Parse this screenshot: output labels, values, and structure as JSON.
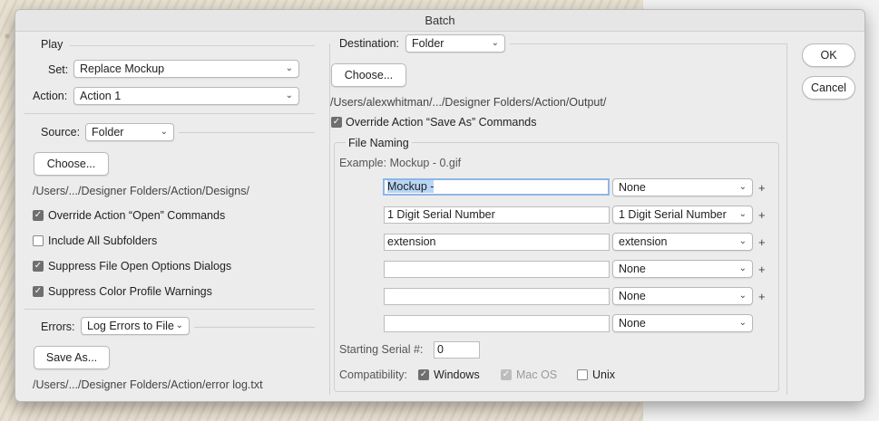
{
  "dialog": {
    "title": "Batch"
  },
  "play": {
    "heading": "Play",
    "set_label": "Set:",
    "set_value": "Replace Mockup",
    "action_label": "Action:",
    "action_value": "Action 1"
  },
  "source": {
    "label": "Source:",
    "value": "Folder",
    "choose_label": "Choose...",
    "path": "/Users/.../Designer Folders/Action/Designs/",
    "checkboxes": [
      {
        "label": "Override Action “Open” Commands",
        "checked": true
      },
      {
        "label": "Include All Subfolders",
        "checked": false
      },
      {
        "label": "Suppress File Open Options Dialogs",
        "checked": true
      },
      {
        "label": "Suppress Color Profile Warnings",
        "checked": true
      }
    ]
  },
  "errors": {
    "label": "Errors:",
    "value": "Log Errors to File",
    "save_as_label": "Save As...",
    "path": "/Users/.../Designer Folders/Action/error log.txt"
  },
  "destination": {
    "label": "Destination:",
    "value": "Folder",
    "choose_label": "Choose...",
    "path": "/Users/alexwhitman/.../Designer Folders/Action/Output/",
    "override_label": "Override Action “Save As” Commands",
    "override_checked": true
  },
  "file_naming": {
    "heading": "File Naming",
    "example": "Example: Mockup - 0.gif",
    "rows": [
      {
        "text": "Mockup - ",
        "select": "None"
      },
      {
        "text": "1 Digit Serial Number",
        "select": "1 Digit Serial Number"
      },
      {
        "text": "extension",
        "select": "extension"
      },
      {
        "text": "",
        "select": "None"
      },
      {
        "text": "",
        "select": "None"
      },
      {
        "text": "",
        "select": "None"
      }
    ],
    "plus_symbol": "+",
    "starting_serial_label": "Starting Serial #:",
    "starting_serial_value": "0",
    "compatibility_label": "Compatibility:",
    "compat_windows": "Windows",
    "compat_mac": "Mac OS",
    "compat_unix": "Unix"
  },
  "buttons": {
    "ok": "OK",
    "cancel": "Cancel"
  },
  "icons": {
    "chevron": "chevron-down-icon",
    "check": "checkmark-icon"
  }
}
